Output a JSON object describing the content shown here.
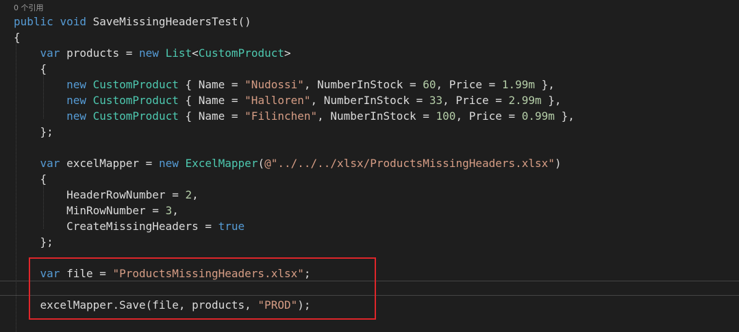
{
  "editor": {
    "codelens": "0 个引用",
    "lines": [
      {
        "tokens": [
          {
            "t": "public",
            "c": "kw"
          },
          {
            "t": " ",
            "c": "pn"
          },
          {
            "t": "void",
            "c": "kw"
          },
          {
            "t": " SaveMissingHeadersTest",
            "c": "id"
          },
          {
            "t": "()",
            "c": "pn"
          }
        ]
      },
      {
        "tokens": [
          {
            "t": "{",
            "c": "pn"
          }
        ]
      },
      {
        "tokens": [
          {
            "t": "    ",
            "c": "pn"
          },
          {
            "t": "var",
            "c": "kw"
          },
          {
            "t": " products = ",
            "c": "id"
          },
          {
            "t": "new",
            "c": "kw"
          },
          {
            "t": " ",
            "c": "pn"
          },
          {
            "t": "List",
            "c": "ty"
          },
          {
            "t": "<",
            "c": "pn"
          },
          {
            "t": "CustomProduct",
            "c": "ty"
          },
          {
            "t": ">",
            "c": "pn"
          }
        ]
      },
      {
        "tokens": [
          {
            "t": "    {",
            "c": "pn"
          }
        ]
      },
      {
        "tokens": [
          {
            "t": "        ",
            "c": "pn"
          },
          {
            "t": "new",
            "c": "kw"
          },
          {
            "t": " ",
            "c": "pn"
          },
          {
            "t": "CustomProduct",
            "c": "ty"
          },
          {
            "t": " { Name = ",
            "c": "id"
          },
          {
            "t": "\"Nudossi\"",
            "c": "st"
          },
          {
            "t": ", NumberInStock = ",
            "c": "id"
          },
          {
            "t": "60",
            "c": "nu"
          },
          {
            "t": ", Price = ",
            "c": "id"
          },
          {
            "t": "1.99m",
            "c": "nu"
          },
          {
            "t": " },",
            "c": "pn"
          }
        ]
      },
      {
        "tokens": [
          {
            "t": "        ",
            "c": "pn"
          },
          {
            "t": "new",
            "c": "kw"
          },
          {
            "t": " ",
            "c": "pn"
          },
          {
            "t": "CustomProduct",
            "c": "ty"
          },
          {
            "t": " { Name = ",
            "c": "id"
          },
          {
            "t": "\"Halloren\"",
            "c": "st"
          },
          {
            "t": ", NumberInStock = ",
            "c": "id"
          },
          {
            "t": "33",
            "c": "nu"
          },
          {
            "t": ", Price = ",
            "c": "id"
          },
          {
            "t": "2.99m",
            "c": "nu"
          },
          {
            "t": " },",
            "c": "pn"
          }
        ]
      },
      {
        "tokens": [
          {
            "t": "        ",
            "c": "pn"
          },
          {
            "t": "new",
            "c": "kw"
          },
          {
            "t": " ",
            "c": "pn"
          },
          {
            "t": "CustomProduct",
            "c": "ty"
          },
          {
            "t": " { Name = ",
            "c": "id"
          },
          {
            "t": "\"Filinchen\"",
            "c": "st"
          },
          {
            "t": ", NumberInStock = ",
            "c": "id"
          },
          {
            "t": "100",
            "c": "nu"
          },
          {
            "t": ", Price = ",
            "c": "id"
          },
          {
            "t": "0.99m",
            "c": "nu"
          },
          {
            "t": " },",
            "c": "pn"
          }
        ]
      },
      {
        "tokens": [
          {
            "t": "    };",
            "c": "pn"
          }
        ]
      },
      {
        "tokens": []
      },
      {
        "tokens": [
          {
            "t": "    ",
            "c": "pn"
          },
          {
            "t": "var",
            "c": "kw"
          },
          {
            "t": " excelMapper = ",
            "c": "id"
          },
          {
            "t": "new",
            "c": "kw"
          },
          {
            "t": " ",
            "c": "pn"
          },
          {
            "t": "ExcelMapper",
            "c": "ty"
          },
          {
            "t": "(",
            "c": "pn"
          },
          {
            "t": "@\"../../../xlsx/ProductsMissingHeaders.xlsx\"",
            "c": "st"
          },
          {
            "t": ")",
            "c": "pn"
          }
        ]
      },
      {
        "tokens": [
          {
            "t": "    {",
            "c": "pn"
          }
        ]
      },
      {
        "tokens": [
          {
            "t": "        HeaderRowNumber = ",
            "c": "id"
          },
          {
            "t": "2",
            "c": "nu"
          },
          {
            "t": ",",
            "c": "pn"
          }
        ]
      },
      {
        "tokens": [
          {
            "t": "        MinRowNumber = ",
            "c": "id"
          },
          {
            "t": "3",
            "c": "nu"
          },
          {
            "t": ",",
            "c": "pn"
          }
        ]
      },
      {
        "tokens": [
          {
            "t": "        CreateMissingHeaders = ",
            "c": "id"
          },
          {
            "t": "true",
            "c": "kw"
          }
        ]
      },
      {
        "tokens": [
          {
            "t": "    };",
            "c": "pn"
          }
        ]
      },
      {
        "tokens": []
      },
      {
        "tokens": [
          {
            "t": "    ",
            "c": "pn"
          },
          {
            "t": "var",
            "c": "kw"
          },
          {
            "t": " file = ",
            "c": "id"
          },
          {
            "t": "\"ProductsMissingHeaders.xlsx\"",
            "c": "st"
          },
          {
            "t": ";",
            "c": "pn"
          }
        ]
      },
      {
        "tokens": []
      },
      {
        "tokens": [
          {
            "t": "    excelMapper.",
            "c": "id"
          },
          {
            "t": "Save",
            "c": "me"
          },
          {
            "t": "(file, products, ",
            "c": "id"
          },
          {
            "t": "\"PROD\"",
            "c": "st"
          },
          {
            "t": ");",
            "c": "pn"
          }
        ]
      }
    ]
  },
  "colors": {
    "background": "#1e1e1e",
    "keyword": "#569cd6",
    "type": "#4ec9b0",
    "string": "#d69d85",
    "number": "#b5cea8",
    "text": "#dcdcdc",
    "highlight_box": "#e0262a"
  }
}
